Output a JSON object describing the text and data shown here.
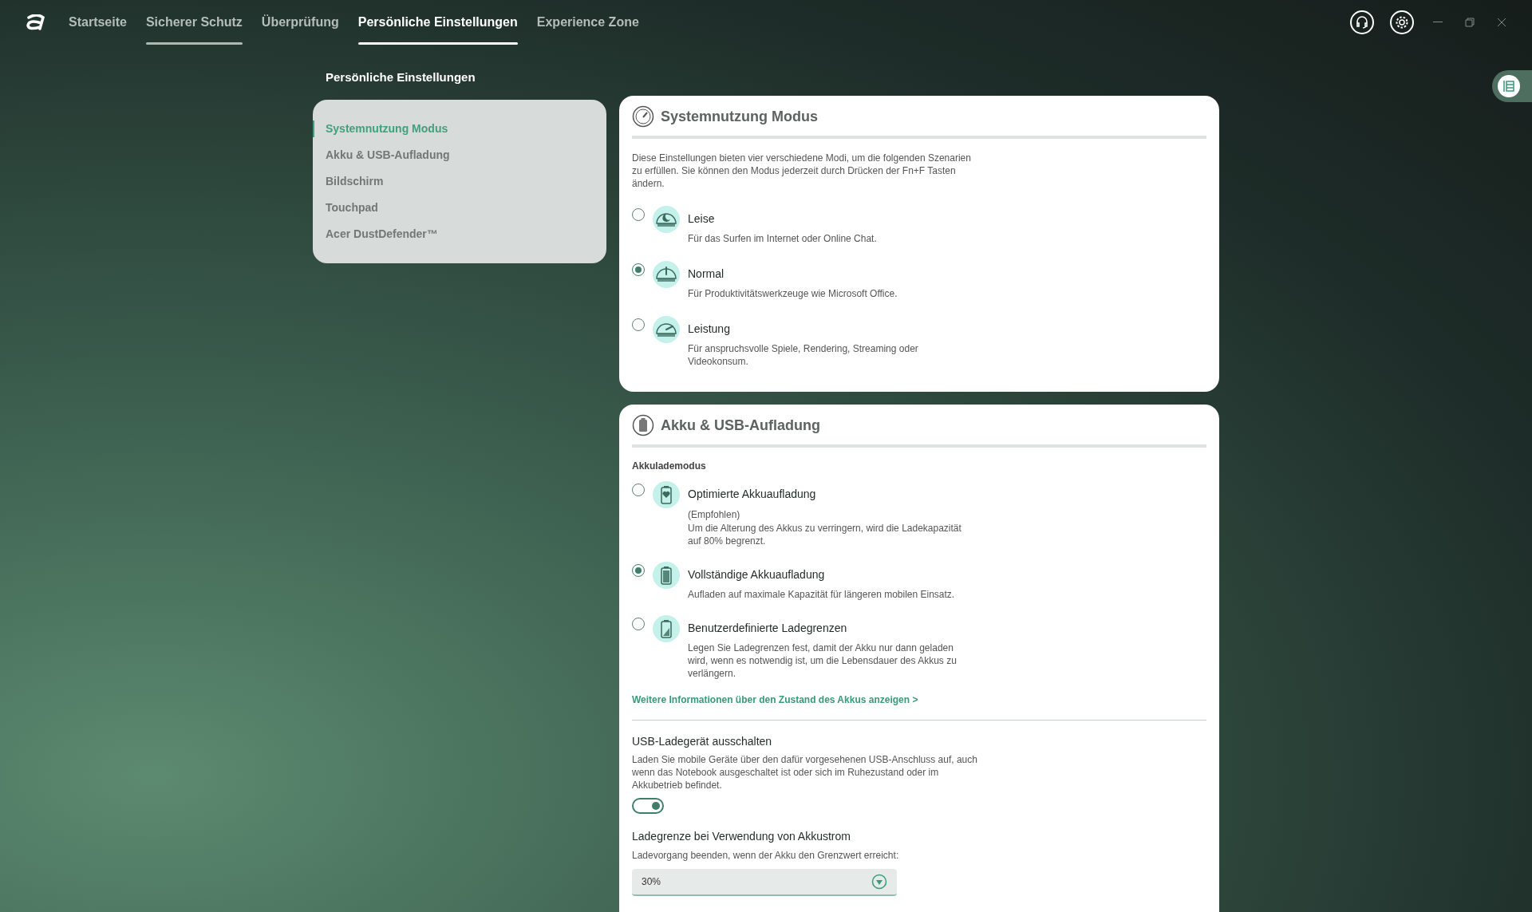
{
  "nav": {
    "tabs": [
      {
        "label": "Startseite",
        "selected": false,
        "hovered": false
      },
      {
        "label": "Sicherer Schutz",
        "selected": false,
        "hovered": true
      },
      {
        "label": "Überprüfung",
        "selected": false,
        "hovered": false
      },
      {
        "label": "Persönliche Einstellungen",
        "selected": true,
        "hovered": false
      },
      {
        "label": "Experience Zone",
        "selected": false,
        "hovered": false
      }
    ]
  },
  "sidebar": {
    "title": "Persönliche Einstellungen",
    "items": [
      {
        "label": "Systemnutzung Modus",
        "selected": true
      },
      {
        "label": "Akku & USB-Aufladung",
        "selected": false
      },
      {
        "label": "Bildschirm",
        "selected": false
      },
      {
        "label": "Touchpad",
        "selected": false
      },
      {
        "label": "Acer DustDefender™",
        "selected": false
      }
    ]
  },
  "mode_card": {
    "title": "Systemnutzung Modus",
    "description": "Diese Einstellungen bieten vier verschiedene Modi, um die folgenden Szenarien zu erfüllen. Sie können den Modus jederzeit durch Drücken der Fn+F Tasten ändern.",
    "options": [
      {
        "kind": "quiet",
        "label": "Leise",
        "description": "Für das Surfen im Internet oder Online Chat.",
        "selected": false
      },
      {
        "kind": "normal",
        "label": "Normal",
        "description": "Für Produktivitätswerkzeuge wie Microsoft Office.",
        "selected": true
      },
      {
        "kind": "performance",
        "label": "Leistung",
        "description": "Für anspruchsvolle Spiele, Rendering, Streaming oder Videokonsum.",
        "selected": false
      }
    ]
  },
  "battery_card": {
    "title": "Akku & USB-Aufladung",
    "section_label": "Akkulademodus",
    "options": [
      {
        "kind": "heart",
        "label": "Optimierte Akkuaufladung",
        "note": "(Empfohlen)",
        "description": "Um die Alterung des Akkus zu verringern, wird die Ladekapazität auf 80% begrenzt.",
        "selected": false
      },
      {
        "kind": "full",
        "label": "Vollständige Akkuaufladung",
        "description": "Aufladen auf maximale Kapazität für längeren mobilen Einsatz.",
        "selected": true
      },
      {
        "kind": "custom",
        "label": "Benutzerdefinierte Ladegrenzen",
        "description": "Legen Sie Ladegrenzen fest, damit der Akku nur dann geladen wird, wenn es notwendig ist, um die Lebensdauer des Akkus zu verlängern.",
        "selected": false
      }
    ],
    "link": "Weitere Informationen über den Zustand des Akkus anzeigen >",
    "usb": {
      "title": "USB-Ladegerät ausschalten",
      "description": "Laden Sie mobile Geräte über den dafür vorgesehenen USB-Anschluss auf, auch wenn das Notebook ausgeschaltet ist oder sich im Ruhezustand oder im Akkubetrieb befindet.",
      "on": true
    },
    "limit": {
      "title": "Ladegrenze bei Verwendung von Akkustrom",
      "description": "Ladevorgang beenden, wenn der Akku den Grenzwert erreicht:",
      "value": "30%"
    }
  }
}
